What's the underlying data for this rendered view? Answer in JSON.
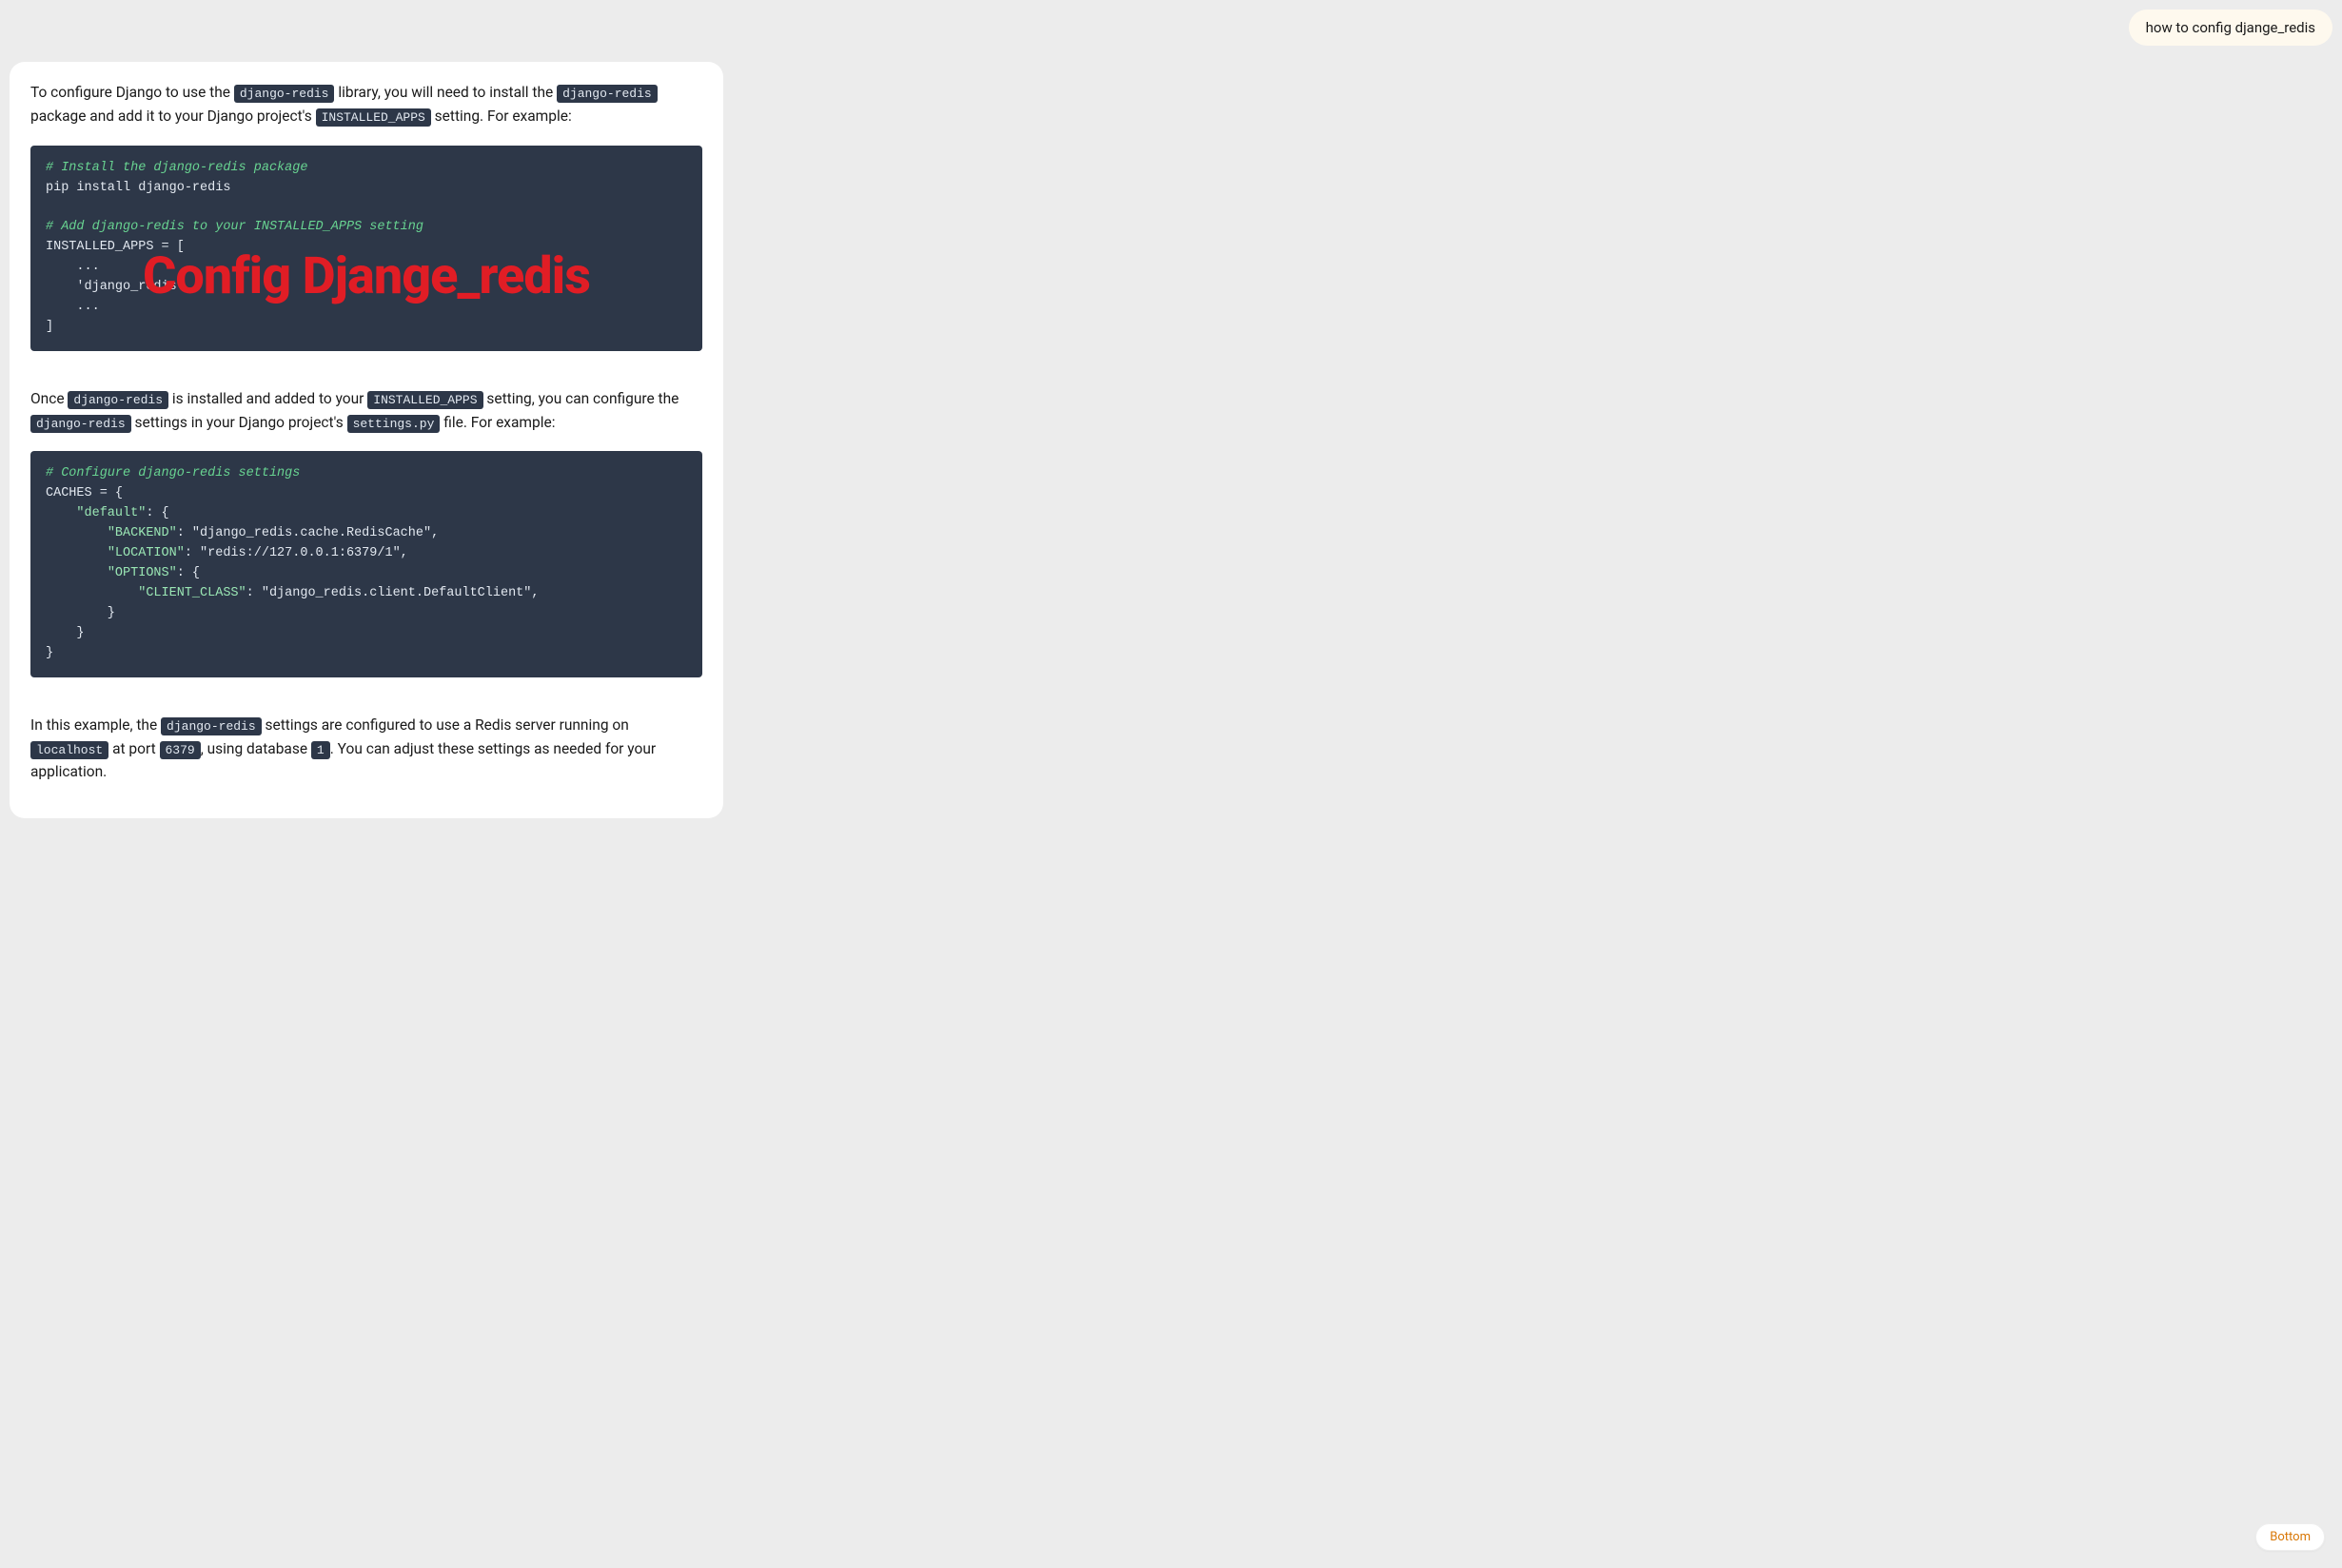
{
  "user_message": "how to config djange_redis",
  "overlay_title": "Config Djange_redis",
  "bottom_button": "Bottom",
  "paragraphs": {
    "p1_seg1": "To configure Django to use the ",
    "p1_code1": "django-redis",
    "p1_seg2": " library, you will need to install the ",
    "p1_code2": "django-redis",
    "p1_seg3": " package and add it to your Django project's ",
    "p1_code3": "INSTALLED_APPS",
    "p1_seg4": " setting. For example:",
    "p2_seg1": "Once ",
    "p2_code1": "django-redis",
    "p2_seg2": " is installed and added to your ",
    "p2_code2": "INSTALLED_APPS",
    "p2_seg3": " setting, you can configure the ",
    "p2_code3": "django-redis",
    "p2_seg4": " settings in your Django project's ",
    "p2_code4": "settings.py",
    "p2_seg5": " file. For example:",
    "p3_seg1": "In this example, the ",
    "p3_code1": "django-redis",
    "p3_seg2": " settings are configured to use a Redis server running on ",
    "p3_code2": "localhost",
    "p3_seg3": " at port ",
    "p3_code3": "6379",
    "p3_seg4": ", using database ",
    "p3_code4": "1",
    "p3_seg5": ". You can adjust these settings as needed for your application."
  },
  "code_block_1": {
    "c1": "# Install the django-redis package",
    "l2": "pip install django-redis",
    "l3": "",
    "c2": "# Add django-redis to your INSTALLED_APPS setting",
    "l5": "INSTALLED_APPS = [",
    "l6": "    ...",
    "l7": "    'django_redis',",
    "l8": "    ...",
    "l9": "]"
  },
  "code_block_2": {
    "c1": "# Configure django-redis settings",
    "l2": "CACHES = {",
    "k1p": "    ",
    "k1": "\"default\"",
    "k1s": ": {",
    "k2p": "        ",
    "k2": "\"BACKEND\"",
    "k2s": ": \"django_redis.cache.RedisCache\",",
    "k3p": "        ",
    "k3": "\"LOCATION\"",
    "k3s": ": \"redis://127.0.0.1:6379/1\",",
    "k4p": "        ",
    "k4": "\"OPTIONS\"",
    "k4s": ": {",
    "k5p": "            ",
    "k5": "\"CLIENT_CLASS\"",
    "k5s": ": \"django_redis.client.DefaultClient\",",
    "l8": "        }",
    "l9": "    }",
    "l10": "}"
  }
}
